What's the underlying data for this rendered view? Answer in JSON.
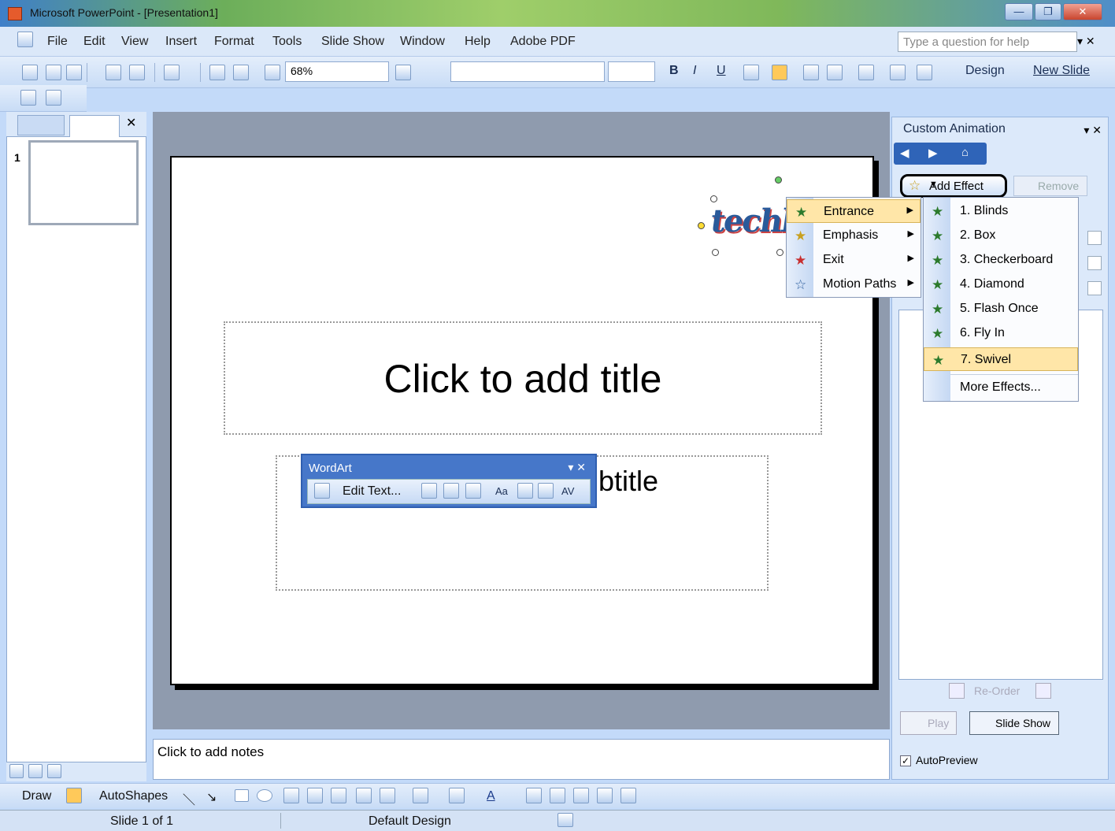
{
  "window": {
    "title": "Microsoft PowerPoint - [Presentation1]"
  },
  "menu": [
    "File",
    "Edit",
    "View",
    "Insert",
    "Format",
    "Tools",
    "Slide Show",
    "Window",
    "Help",
    "Adobe PDF"
  ],
  "help_placeholder": "Type a question for help",
  "toolbar": {
    "zoom": "68%",
    "design": "Design",
    "new_slide": "New Slide"
  },
  "slide_panel": {
    "slide_number": "1"
  },
  "slide": {
    "title_placeholder": "Click to add title",
    "subtitle_partial": "btitle"
  },
  "wordart_toolbar": {
    "title": "WordArt",
    "edit_text": "Edit Text...",
    "buttons": [
      "Aa",
      "AV"
    ]
  },
  "notes": {
    "placeholder": "Click to add notes"
  },
  "task_pane": {
    "title": "Custom Animation",
    "add_effect": "Add Effect",
    "remove": "Remove",
    "reorder": "Re-Order",
    "play": "Play",
    "slide_show": "Slide Show",
    "autopreview": "AutoPreview",
    "autopreview_checked": "✓"
  },
  "effect_menu": {
    "items": [
      "Entrance",
      "Emphasis",
      "Exit",
      "Motion Paths"
    ]
  },
  "entrance_menu": {
    "items": [
      "1. Blinds",
      "2. Box",
      "3. Checkerboard",
      "4. Diamond",
      "5. Flash Once",
      "6. Fly In",
      "7. Swivel",
      "More Effects..."
    ],
    "selected": "7. Swivel"
  },
  "draw_toolbar": {
    "draw": "Draw",
    "autoshapes": "AutoShapes"
  },
  "status": {
    "slide": "Slide 1 of 1",
    "design": "Default Design"
  }
}
